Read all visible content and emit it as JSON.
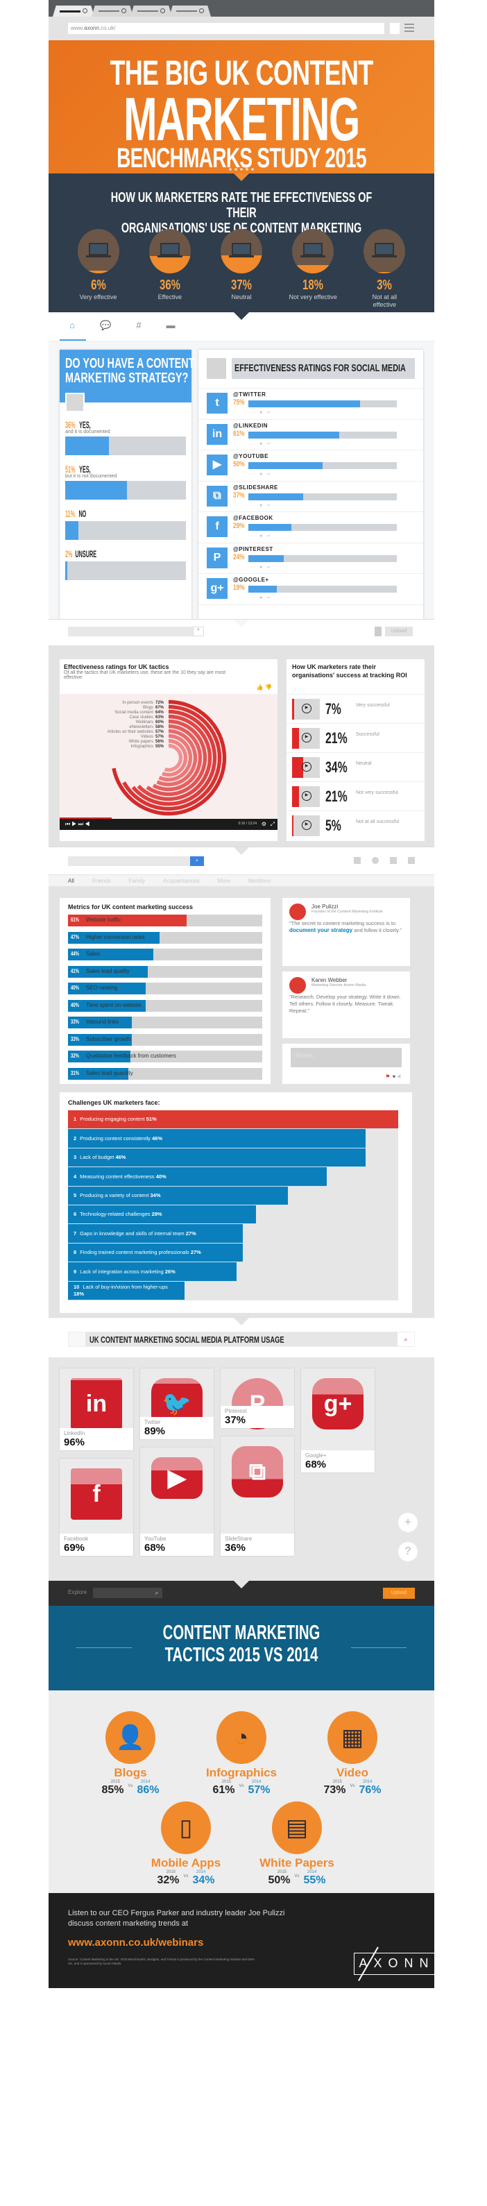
{
  "browser": {
    "url_prefix": "www.",
    "url_domain": "axonn",
    "url_suffix": ".co.uk/",
    "tabs_count": 4
  },
  "hero": {
    "line1": "THE BIG UK CONTENT",
    "line2": "MARKETING",
    "line3": "BENCHMARKS STUDY 2015",
    "bg_color": "#ee7d22"
  },
  "effectiveness": {
    "title_line1": "HOW UK MARKETERS RATE THE EFFECTIVENESS OF THEIR",
    "title_line2": "ORGANISATIONS' USE OF CONTENT MARKETING",
    "items": [
      {
        "pct": "6%",
        "value": 6,
        "label": "Very effective"
      },
      {
        "pct": "36%",
        "value": 36,
        "label": "Effective"
      },
      {
        "pct": "37%",
        "value": 37,
        "label": "Neutral"
      },
      {
        "pct": "18%",
        "value": 18,
        "label": "Not very effective"
      },
      {
        "pct": "3%",
        "value": 3,
        "label": "Not at all effective"
      }
    ]
  },
  "twitter_section": {
    "nav_icons": [
      "home-icon",
      "messages-icon",
      "hashtag-icon",
      "mail-icon"
    ],
    "strategy": {
      "title_line1": "DO YOU HAVE A CONTENT",
      "title_line2": "MARKETING STRATEGY?",
      "items": [
        {
          "pct": "36%",
          "value": 36,
          "label": "YES,",
          "sub": "and it is documented"
        },
        {
          "pct": "51%",
          "value": 51,
          "label": "YES,",
          "sub": "but it is not documented"
        },
        {
          "pct": "11%",
          "value": 11,
          "label": "NO",
          "sub": ""
        },
        {
          "pct": "2%",
          "value": 2,
          "label": "UNSURE",
          "sub": ""
        }
      ]
    },
    "social": {
      "title": "EFFECTIVENESS RATINGS FOR SOCIAL MEDIA",
      "items": [
        {
          "name": "@TWITTER",
          "pct": "75%",
          "value": 75,
          "icon": "twitter-icon",
          "glyph": "t"
        },
        {
          "name": "@LINKEDIN",
          "pct": "61%",
          "value": 61,
          "icon": "linkedin-icon",
          "glyph": "in"
        },
        {
          "name": "@YOUTUBE",
          "pct": "50%",
          "value": 50,
          "icon": "youtube-icon",
          "glyph": "▶"
        },
        {
          "name": "@SLIDESHARE",
          "pct": "37%",
          "value": 37,
          "icon": "slideshare-icon",
          "glyph": "⧉"
        },
        {
          "name": "@FACEBOOK",
          "pct": "29%",
          "value": 29,
          "icon": "facebook-icon",
          "glyph": "f"
        },
        {
          "name": "@PINTEREST",
          "pct": "24%",
          "value": 24,
          "icon": "pinterest-icon",
          "glyph": "P"
        },
        {
          "name": "@GOOGLE+",
          "pct": "19%",
          "value": 19,
          "icon": "googleplus-icon",
          "glyph": "g+"
        }
      ],
      "actions": "··· ★ ↩"
    }
  },
  "youtube_section": {
    "search_icon": "⌕",
    "upload_label": "Upload",
    "tactics": {
      "title": "Effectiveness ratings for UK tactics",
      "subtitle": "Of all the tactics that UK marketers use, these are the 10 they say are most effective:",
      "thumbs": "👍 👎"
    },
    "player": {
      "controls": "⏮ ▶ ⏭ ◀",
      "time": "0:16 / 13:24",
      "progress": 0.24
    },
    "roi": {
      "title": "How UK marketers rate their organisations' success at tracking ROI",
      "items": [
        {
          "pct": "7%",
          "value": 7,
          "label": "Very successful"
        },
        {
          "pct": "21%",
          "value": 21,
          "label": "Successful"
        },
        {
          "pct": "34%",
          "value": 34,
          "label": "Neutral"
        },
        {
          "pct": "21%",
          "value": 21,
          "label": "Not very successful"
        },
        {
          "pct": "5%",
          "value": 5,
          "label": "Not at all successful"
        }
      ]
    }
  },
  "facebook_section": {
    "tabs": [
      "All",
      "Friends",
      "Family",
      "Acquaintances",
      "More",
      "Mentions"
    ],
    "search_icon": "⌕",
    "quotes": [
      {
        "name": "Joe Pulizzi",
        "role": "Founder of the Content Marketing Institute",
        "text_before": "\"The secret to content marketing success is to ",
        "highlight": "document your strategy",
        "text_after": " and follow it closely.\""
      },
      {
        "name": "Karen Webber",
        "role": "Marketing Director Axonn Media",
        "text_before": "\"Research. Develop your strategy. Write it down. Tell others. Follow it closely. Measure. Tweak. Repeat.\"",
        "highlight": "",
        "text_after": ""
      }
    ],
    "share_placeholder": "Share...",
    "share_icons": [
      "flag-icon",
      "heart-icon",
      "share-icon"
    ]
  },
  "pinterest_section": {
    "title": "UK CONTENT MARKETING SOCIAL MEDIA PLATFORM USAGE",
    "search_icon": "⌕",
    "explore_label": "Explore",
    "upload_label": "Upload",
    "plus_label": "+",
    "help_label": "?"
  },
  "comparison": {
    "title_line1": "CONTENT MARKETING",
    "title_line2": "TACTICS 2015 VS 2014",
    "year_2015": "2015",
    "year_2014": "2014",
    "vs_label": "Vs",
    "items": [
      {
        "name": "Blogs",
        "y2015": "85%",
        "y2014": "86%",
        "icon": "blogger-laptop-icon"
      },
      {
        "name": "Infographics",
        "y2015": "61%",
        "y2014": "57%",
        "icon": "infographic-icon"
      },
      {
        "name": "Video",
        "y2015": "73%",
        "y2014": "76%",
        "icon": "film-strip-icon"
      },
      {
        "name": "Mobile Apps",
        "y2015": "32%",
        "y2014": "34%",
        "icon": "smartphone-icon"
      },
      {
        "name": "White Papers",
        "y2015": "50%",
        "y2014": "55%",
        "icon": "documents-icon"
      }
    ]
  },
  "footer": {
    "text": "Listen to our CEO Fergus Parker and industry leader Joe Pulizzi discuss content marketing trends at",
    "url": "www.axonn.co.uk/webinars",
    "source": "Source: Content Marketing in the UK: 2015 Benchmarks, Budgets, and Trends is produced by the Content Marketing Institute and DMA UK, and is sponsored by Axonn Media.",
    "logo": "AXONN"
  },
  "chart_data": [
    {
      "type": "bar",
      "title": "How UK marketers rate the effectiveness of their organisations' use of content marketing",
      "categories": [
        "Very effective",
        "Effective",
        "Neutral",
        "Not very effective",
        "Not at all effective"
      ],
      "values": [
        6,
        36,
        37,
        18,
        3
      ],
      "ylabel": "%"
    },
    {
      "type": "bar",
      "title": "Do you have a content marketing strategy?",
      "categories": [
        "Yes, and it is documented",
        "Yes, but it is not documented",
        "No",
        "Unsure"
      ],
      "values": [
        36,
        51,
        11,
        2
      ],
      "xlim": [
        0,
        100
      ]
    },
    {
      "type": "bar",
      "title": "Effectiveness ratings for social media",
      "categories": [
        "Twitter",
        "LinkedIn",
        "YouTube",
        "SlideShare",
        "Facebook",
        "Pinterest",
        "Google+"
      ],
      "values": [
        75,
        61,
        50,
        37,
        29,
        24,
        19
      ],
      "xlim": [
        0,
        100
      ]
    },
    {
      "type": "bar",
      "subtype": "radial",
      "title": "Effectiveness ratings for UK tactics",
      "categories": [
        "In-person events",
        "Blogs",
        "Social media content",
        "Case studies",
        "Webinars",
        "eNewsletters",
        "Articles on their websites",
        "Videos",
        "White papers",
        "Infographics"
      ],
      "values": [
        72,
        67,
        64,
        63,
        60,
        58,
        57,
        57,
        56,
        55
      ],
      "xlim": [
        0,
        100
      ]
    },
    {
      "type": "bar",
      "title": "How UK marketers rate their organisations' success at tracking ROI",
      "categories": [
        "Very successful",
        "Successful",
        "Neutral",
        "Not very successful",
        "Not at all successful"
      ],
      "values": [
        7,
        21,
        34,
        21,
        5
      ]
    },
    {
      "type": "bar",
      "title": "Metrics for UK content marketing success",
      "categories": [
        "Website traffic",
        "Higher conversion rates",
        "Sales",
        "Sales lead quality",
        "SEO ranking",
        "Time spent on website",
        "Inbound links",
        "Subscriber growth",
        "Qualitative feedback from customers",
        "Sales lead quantity"
      ],
      "values": [
        61,
        47,
        44,
        41,
        40,
        40,
        33,
        33,
        32,
        31
      ],
      "xlim": [
        0,
        100
      ]
    },
    {
      "type": "bar",
      "title": "Challenges UK marketers face:",
      "categories": [
        "Producing engaging content",
        "Producing content consistently",
        "Lack of budget",
        "Measuring content effectiveness",
        "Producing a variety of content",
        "Technology-related challenges",
        "Gaps in knowledge and skills of internal team",
        "Finding trained content marketing professionals",
        "Lack of integration across marketing",
        "Lack of buy-in/vision from higher-ups"
      ],
      "values": [
        51,
        46,
        46,
        40,
        34,
        29,
        27,
        27,
        26,
        18
      ],
      "xlim": [
        0,
        55
      ]
    },
    {
      "type": "bar",
      "title": "UK content marketing social media platform usage",
      "categories": [
        "LinkedIn",
        "Twitter",
        "Pinterest",
        "Google+",
        "Facebook",
        "YouTube",
        "SlideShare"
      ],
      "values": [
        96,
        89,
        37,
        68,
        69,
        68,
        36
      ]
    },
    {
      "type": "bar",
      "title": "Content marketing tactics 2015 vs 2014",
      "categories": [
        "Blogs",
        "Infographics",
        "Video",
        "Mobile Apps",
        "White Papers"
      ],
      "series": [
        {
          "name": "2015",
          "values": [
            85,
            61,
            73,
            32,
            50
          ]
        },
        {
          "name": "2014",
          "values": [
            86,
            57,
            76,
            34,
            55
          ]
        }
      ]
    }
  ]
}
